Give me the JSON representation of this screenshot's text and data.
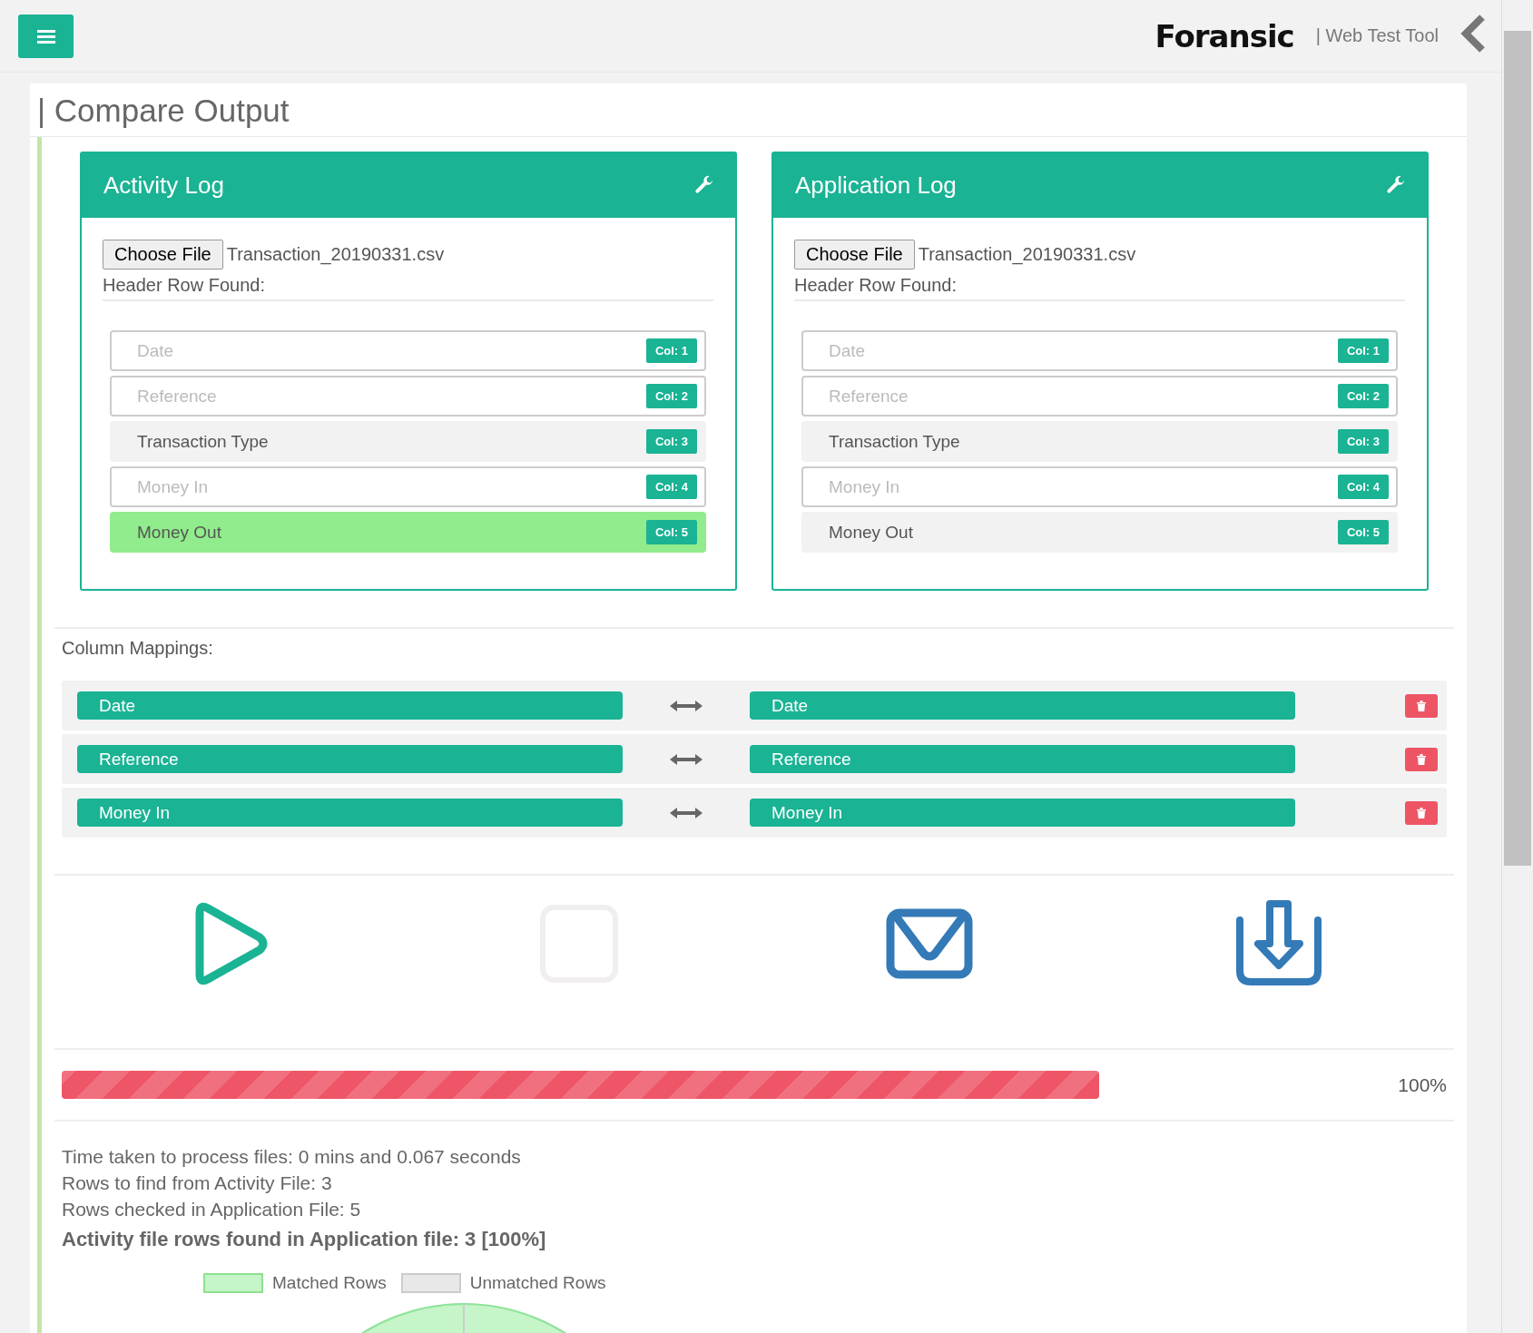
{
  "header": {
    "logo": "Foransic",
    "tagline": "| Web Test Tool"
  },
  "page_title": "| Compare Output",
  "panels": [
    {
      "title": "Activity Log",
      "file_button": "Choose File",
      "file_name": "Transaction_20190331.csv",
      "header_label": "Header Row Found:",
      "columns": [
        {
          "name": "Date",
          "badge": "Col: 1",
          "mapped": true,
          "selected": false
        },
        {
          "name": "Reference",
          "badge": "Col: 2",
          "mapped": true,
          "selected": false
        },
        {
          "name": "Transaction Type",
          "badge": "Col: 3",
          "mapped": false,
          "selected": false
        },
        {
          "name": "Money In",
          "badge": "Col: 4",
          "mapped": true,
          "selected": false
        },
        {
          "name": "Money Out",
          "badge": "Col: 5",
          "mapped": false,
          "selected": true
        }
      ]
    },
    {
      "title": "Application Log",
      "file_button": "Choose File",
      "file_name": "Transaction_20190331.csv",
      "header_label": "Header Row Found:",
      "columns": [
        {
          "name": "Date",
          "badge": "Col: 1",
          "mapped": true,
          "selected": false
        },
        {
          "name": "Reference",
          "badge": "Col: 2",
          "mapped": true,
          "selected": false
        },
        {
          "name": "Transaction Type",
          "badge": "Col: 3",
          "mapped": false,
          "selected": false
        },
        {
          "name": "Money In",
          "badge": "Col: 4",
          "mapped": true,
          "selected": false
        },
        {
          "name": "Money Out",
          "badge": "Col: 5",
          "mapped": false,
          "selected": false
        }
      ]
    }
  ],
  "mappings_label": "Column Mappings:",
  "mappings": [
    {
      "left": "Date",
      "right": "Date"
    },
    {
      "left": "Reference",
      "right": "Reference"
    },
    {
      "left": "Money In",
      "right": "Money In"
    }
  ],
  "actions": [
    {
      "kind": "run",
      "disabled": false
    },
    {
      "kind": "stop",
      "disabled": true
    },
    {
      "kind": "email",
      "disabled": false
    },
    {
      "kind": "download",
      "disabled": false
    }
  ],
  "progress": {
    "level": 1,
    "reading": "100%"
  },
  "results": [
    "Time taken to process files: 0 mins and 0.067 seconds",
    "Rows to find from Activity File: 3",
    "Rows checked in Application File: 5"
  ],
  "summary": "Activity file rows found in Application file: 3 [100%]",
  "chart": {
    "legend": [
      {
        "label": "Matched Rows",
        "color": "#c5f5c8"
      },
      {
        "label": "Unmatched Rows",
        "color": "#e8e8e8"
      }
    ]
  }
}
